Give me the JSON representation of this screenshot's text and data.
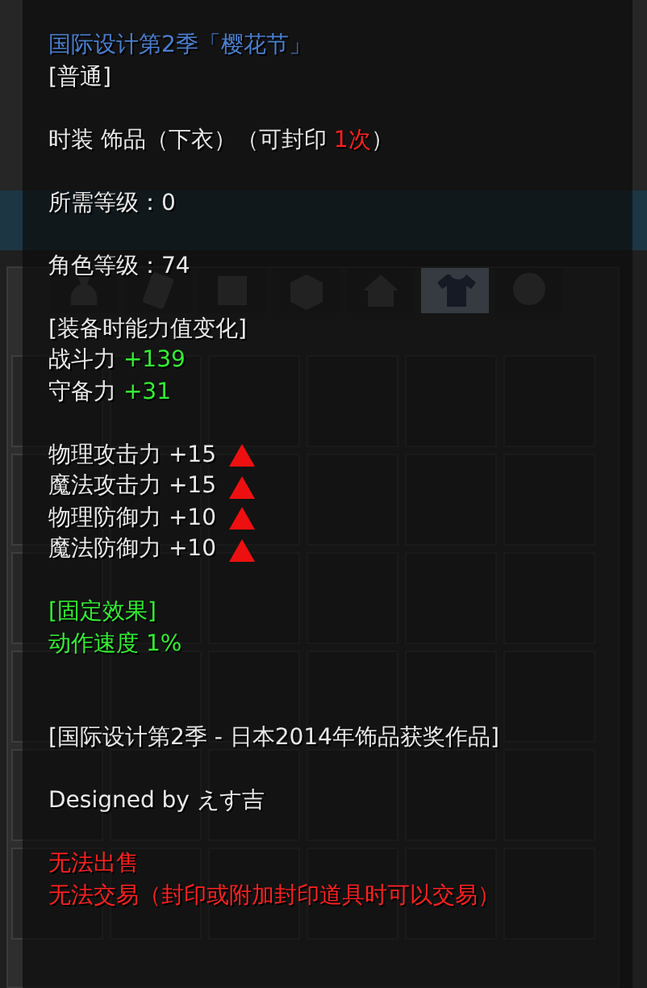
{
  "inventory": {
    "tabs": [
      {
        "selected": false
      },
      {
        "selected": false
      },
      {
        "selected": false
      },
      {
        "selected": false
      },
      {
        "selected": false
      },
      {
        "selected": true
      },
      {
        "selected": false
      }
    ]
  },
  "tooltip": {
    "blocks": [
      {
        "kind": "normal",
        "lines": [
          {
            "kind": "title",
            "text": "国际设计第2季「樱花节」"
          },
          {
            "kind": "text",
            "text": "[普通]"
          }
        ]
      },
      {
        "kind": "normal",
        "lines": [
          {
            "kind": "type",
            "text": "时装 饰品（下衣）（可封印 ",
            "highlight": "1次",
            "suffix": "）"
          }
        ]
      },
      {
        "kind": "normal",
        "lines": [
          {
            "kind": "text",
            "text": "所需等级：0"
          }
        ]
      },
      {
        "kind": "normal",
        "lines": [
          {
            "kind": "text",
            "text": "角色等级：74"
          }
        ]
      },
      {
        "kind": "normal",
        "lines": [
          {
            "kind": "text",
            "text": "[装备时能力值变化]"
          },
          {
            "kind": "bonus",
            "label": "战斗力",
            "value": "+139"
          },
          {
            "kind": "bonus",
            "label": "守备力",
            "value": "+31"
          }
        ]
      },
      {
        "kind": "normal",
        "lines": [
          {
            "kind": "stat",
            "label": "物理攻击力",
            "value": "+15"
          },
          {
            "kind": "stat",
            "label": "魔法攻击力",
            "value": "+15"
          },
          {
            "kind": "stat",
            "label": "物理防御力",
            "value": "+10"
          },
          {
            "kind": "stat",
            "label": "魔法防御力",
            "value": "+10"
          }
        ]
      },
      {
        "kind": "normal",
        "lines": [
          {
            "kind": "effect",
            "text": "[固定效果]"
          },
          {
            "kind": "effect",
            "text": "动作速度 1%"
          }
        ]
      },
      {
        "kind": "note",
        "lines": [
          {
            "kind": "text",
            "text": "[国际设计第2季 - 日本2014年饰品获奖作品]"
          }
        ]
      },
      {
        "kind": "normal",
        "lines": [
          {
            "kind": "text",
            "text": "Designed by えす吉"
          }
        ]
      },
      {
        "kind": "normal",
        "lines": [
          {
            "kind": "warning",
            "text": "无法出售"
          },
          {
            "kind": "warning",
            "text": "无法交易（封印或附加封印道具时可以交易）"
          }
        ]
      }
    ]
  }
}
